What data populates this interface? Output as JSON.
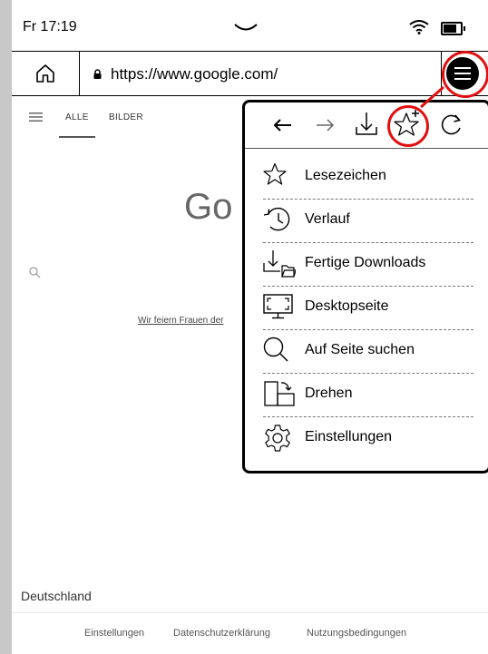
{
  "status_bar": {
    "time": "Fr 17:19"
  },
  "address_bar": {
    "url": "https://www.google.com/"
  },
  "google_page": {
    "nav_all": "ALLE",
    "nav_images": "BILDER",
    "logo_partial": "Go",
    "doodle_link": "Wir feiern Frauen der",
    "country": "Deutschland",
    "footer_links": [
      "Einstellungen",
      "Datenschutzerklärung",
      "Nutzungsbedingungen"
    ]
  },
  "menu": {
    "items": [
      {
        "label": "Lesezeichen",
        "icon": "star-icon"
      },
      {
        "label": "Verlauf",
        "icon": "history-icon"
      },
      {
        "label": "Fertige Downloads",
        "icon": "downloads-folder-icon"
      },
      {
        "label": "Desktopseite",
        "icon": "desktop-icon"
      },
      {
        "label": "Auf Seite suchen",
        "icon": "search-icon"
      },
      {
        "label": "Drehen",
        "icon": "rotate-icon"
      },
      {
        "label": "Einstellungen",
        "icon": "settings-gear-icon"
      }
    ]
  },
  "colors": {
    "highlight": "#e01010"
  }
}
